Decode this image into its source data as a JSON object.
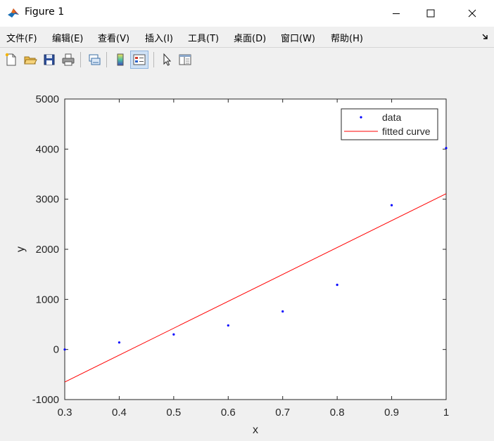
{
  "window": {
    "title": "Figure 1",
    "app_icon": "matlab-icon",
    "controls": [
      "minimize-icon",
      "maximize-icon",
      "close-icon"
    ]
  },
  "menu": {
    "items": [
      {
        "label": "文件(F)"
      },
      {
        "label": "编辑(E)"
      },
      {
        "label": "查看(V)"
      },
      {
        "label": "插入(I)"
      },
      {
        "label": "工具(T)"
      },
      {
        "label": "桌面(D)"
      },
      {
        "label": "窗口(W)"
      },
      {
        "label": "帮助(H)"
      }
    ],
    "dock_icon": "dock-arrow-icon"
  },
  "toolbar": {
    "buttons": [
      {
        "icon": "new-figure-icon"
      },
      {
        "icon": "open-file-icon"
      },
      {
        "icon": "save-icon"
      },
      {
        "icon": "print-icon"
      },
      {
        "icon": "link-plot-icon"
      },
      {
        "icon": "colorbar-icon"
      },
      {
        "icon": "legend-icon",
        "active": true
      },
      {
        "icon": "edit-plot-pointer-icon"
      },
      {
        "icon": "property-inspector-icon"
      }
    ]
  },
  "chart_data": {
    "type": "scatter",
    "xlabel": "x",
    "ylabel": "y",
    "xlim": [
      0.3,
      1.0
    ],
    "ylim": [
      -1000,
      5000
    ],
    "xticks": [
      "0.3",
      "0.4",
      "0.5",
      "0.6",
      "0.7",
      "0.8",
      "0.9",
      "1"
    ],
    "yticks": [
      "-1000",
      "0",
      "1000",
      "2000",
      "3000",
      "4000",
      "5000"
    ],
    "grid": false,
    "legend": "top-right",
    "series": [
      {
        "name": "data",
        "style": "points",
        "color": "#0000ff",
        "x": [
          0.3,
          0.4,
          0.5,
          0.6,
          0.7,
          0.8,
          0.9,
          1.0
        ],
        "y": [
          0,
          140,
          300,
          480,
          760,
          1290,
          2880,
          4020
        ]
      },
      {
        "name": "fitted curve",
        "style": "line",
        "color": "#ff0000",
        "x": [
          0.3,
          1.0
        ],
        "y": [
          -650,
          3110
        ]
      }
    ]
  }
}
